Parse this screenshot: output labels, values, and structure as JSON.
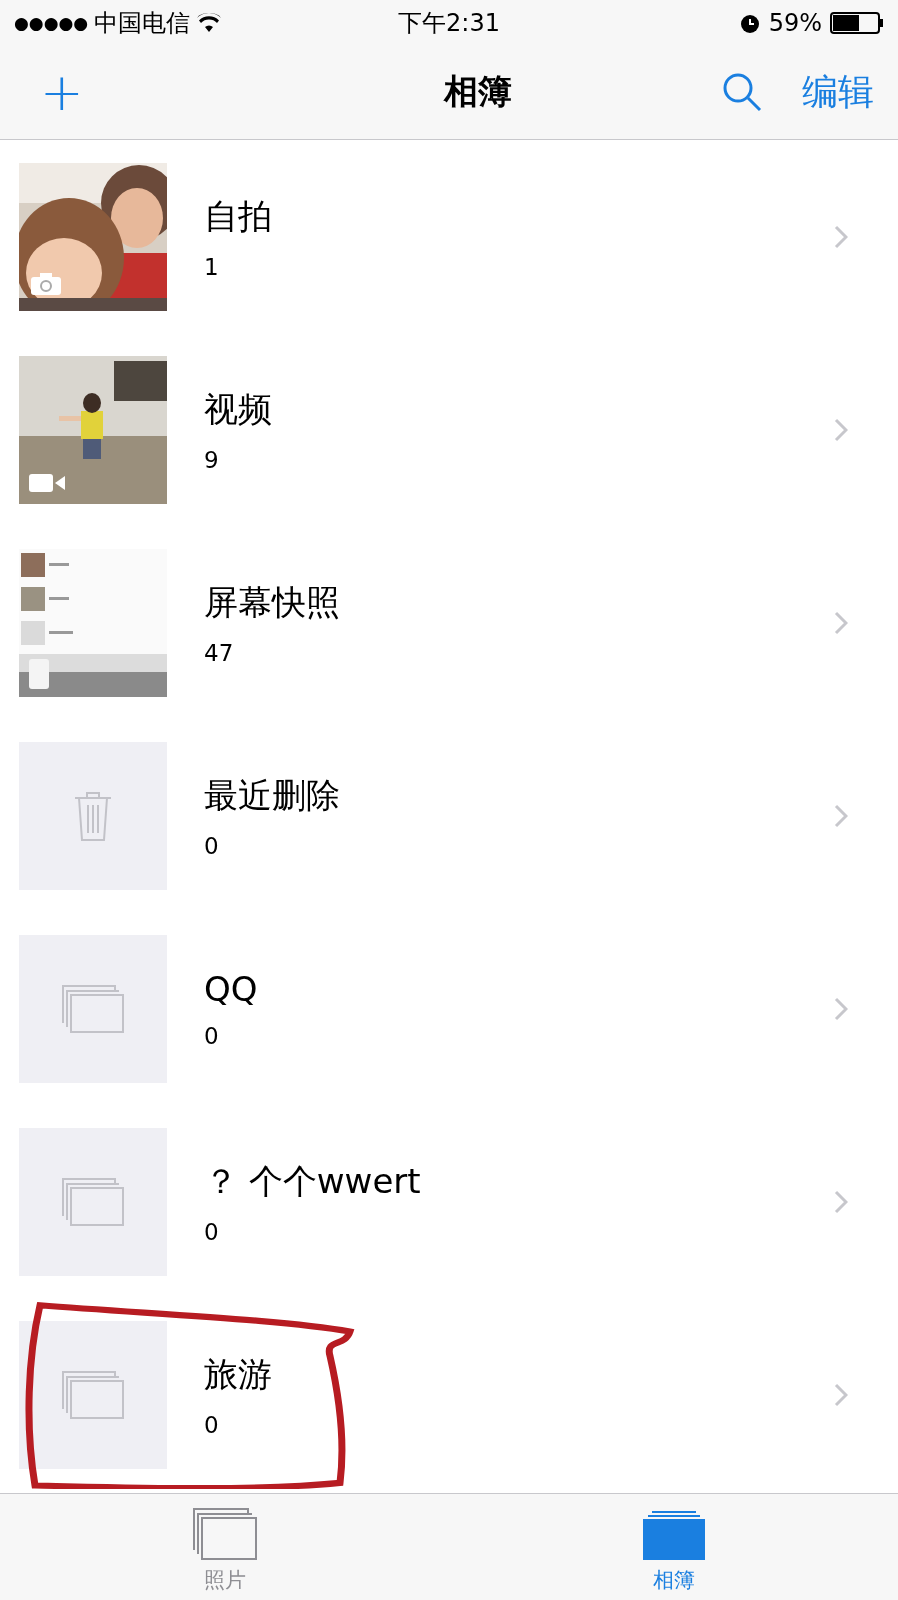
{
  "status_bar": {
    "signal": "●●●●●",
    "carrier": "中国电信",
    "time": "下午2:31",
    "battery": "59%"
  },
  "nav_bar": {
    "add": "+",
    "title": "相簿",
    "edit": "编辑"
  },
  "albums": [
    {
      "kind": "selfie",
      "title": "自拍",
      "count": "1",
      "circled": false
    },
    {
      "kind": "video",
      "title": "视频",
      "count": "9",
      "circled": false
    },
    {
      "kind": "screenshot",
      "title": "屏幕快照",
      "count": "47",
      "circled": false
    },
    {
      "kind": "trash",
      "title": "最近删除",
      "count": "0",
      "circled": false
    },
    {
      "kind": "empty",
      "title": "QQ",
      "count": "0",
      "circled": false
    },
    {
      "kind": "empty",
      "title": "？ 个个wwert",
      "count": "0",
      "circled": false
    },
    {
      "kind": "empty",
      "title": "旅游",
      "count": "0",
      "circled": true
    }
  ],
  "tab_bar": [
    {
      "label": "照片",
      "selected": false
    },
    {
      "label": "相簿",
      "selected": true
    }
  ]
}
